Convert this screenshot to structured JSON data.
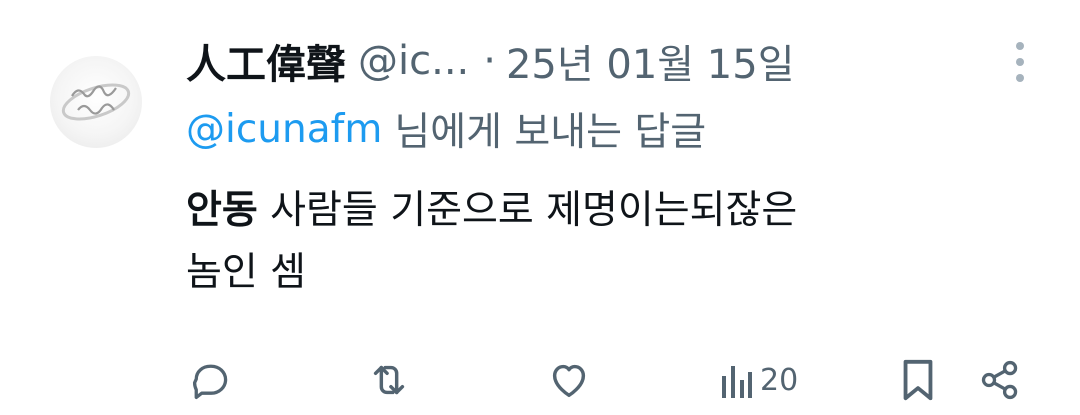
{
  "tweet": {
    "author": {
      "display_name": "人工偉聲",
      "handle": "@ic...",
      "separator": "·",
      "date": "25년 01월 15일",
      "avatar_icon": "ring-avatar-icon"
    },
    "reply_to": {
      "mention": "@icunafm",
      "suffix": "님에게 보내는 답글"
    },
    "body": {
      "bold_word": "안동",
      "line1_rest": " 사람들 기준으로 제명이는되잖은",
      "line2": "놈인 셈"
    },
    "metrics": {
      "views": "20"
    },
    "colors": {
      "mention": "#1d9bf0",
      "secondary_text": "#536471",
      "primary_text": "#0f1419",
      "more_dots": "#a6b3bd"
    },
    "icons": {
      "more": "more-vertical-icon",
      "reply": "reply-icon",
      "retweet": "retweet-icon",
      "like": "heart-icon",
      "views": "views-icon",
      "bookmark": "bookmark-icon",
      "share": "share-icon"
    }
  }
}
